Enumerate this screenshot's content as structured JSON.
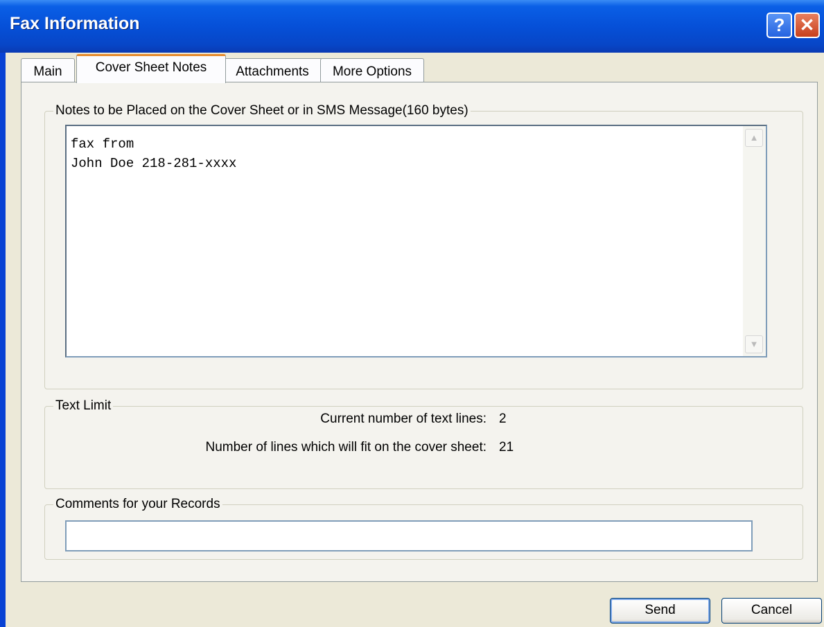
{
  "window": {
    "title": "Fax Information",
    "help_symbol": "?",
    "close_symbol": "✕"
  },
  "tabs": [
    {
      "label": "Main",
      "active": false
    },
    {
      "label": "Cover Sheet Notes",
      "active": true
    },
    {
      "label": "Attachments",
      "active": false
    },
    {
      "label": "More Options",
      "active": false
    }
  ],
  "notes": {
    "legend": "Notes to be Placed on the Cover Sheet or in SMS Message(160 bytes)",
    "text": "fax from\nJohn Doe 218-281-xxxx",
    "scroll_up": "▲",
    "scroll_down": "▼"
  },
  "text_limit": {
    "legend": "Text Limit",
    "current_label": "Current number of text lines:",
    "current_value": "2",
    "fit_label": "Number of lines which will fit on the cover sheet:",
    "fit_value": "21"
  },
  "comments": {
    "legend": "Comments for your Records",
    "value": ""
  },
  "buttons": {
    "send": "Send",
    "cancel": "Cancel"
  },
  "colors": {
    "titlebar": "#0650d8",
    "active_tab_accent": "#e68b2c",
    "panel": "#f4f3ee",
    "window_bg": "#ece9d8"
  }
}
